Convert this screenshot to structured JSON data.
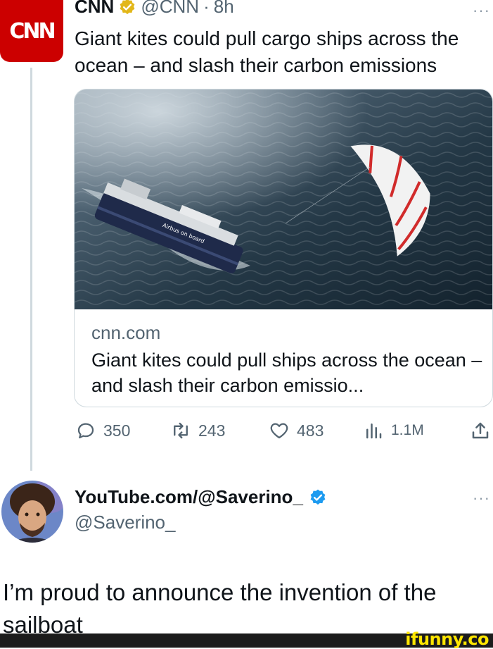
{
  "tweet1": {
    "avatar_text": "CNN",
    "name": "CNN",
    "handle": "@CNN",
    "separator": "·",
    "time": "8h",
    "more": "···",
    "text": "Giant kites could pull cargo ships across the ocean – and slash their carbon emissions",
    "card": {
      "image_text": "Airbus on board",
      "domain": "cnn.com",
      "title": "Giant kites could pull ships across the ocean – and slash their carbon emissio..."
    },
    "actions": {
      "replies": "350",
      "retweets": "243",
      "likes": "483",
      "views": "1.1M"
    }
  },
  "tweet2": {
    "name": "YouTube.com/@Saverino_",
    "handle": "@Saverino_",
    "more": "···",
    "text": "I’m proud to announce the invention of the sailboat"
  },
  "footer": {
    "watermark": "ifunny.co"
  },
  "colors": {
    "cnn_red": "#cc0000",
    "verified_gold": "#e2b719",
    "verified_blue": "#1d9bf0",
    "secondary_text": "#536471"
  }
}
